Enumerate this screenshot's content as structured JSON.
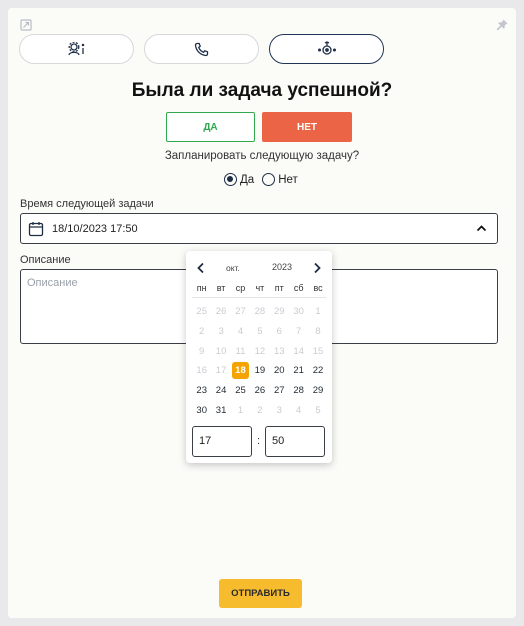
{
  "question_title": "Была ли задача успешной?",
  "answer_buttons": {
    "yes": "ДА",
    "no": "НЕТ"
  },
  "schedule": {
    "question": "Запланировать следующую задачу?",
    "options": [
      {
        "label": "Да",
        "checked": true
      },
      {
        "label": "Нет",
        "checked": false
      }
    ]
  },
  "next_time": {
    "label": "Время следующей задачи",
    "value": "18/10/2023 17:50"
  },
  "description": {
    "label": "Описание",
    "placeholder": "Описание"
  },
  "datepicker": {
    "month": "окт.",
    "year": "2023",
    "weekdays": [
      "пн",
      "вт",
      "ср",
      "чт",
      "пт",
      "сб",
      "вс"
    ],
    "days": [
      {
        "d": "25",
        "muted": true
      },
      {
        "d": "26",
        "muted": true
      },
      {
        "d": "27",
        "muted": true
      },
      {
        "d": "28",
        "muted": true
      },
      {
        "d": "29",
        "muted": true
      },
      {
        "d": "30",
        "muted": true
      },
      {
        "d": "1",
        "muted": true
      },
      {
        "d": "2",
        "muted": true
      },
      {
        "d": "3",
        "muted": true
      },
      {
        "d": "4",
        "muted": true
      },
      {
        "d": "5",
        "muted": true
      },
      {
        "d": "6",
        "muted": true
      },
      {
        "d": "7",
        "muted": true
      },
      {
        "d": "8",
        "muted": true
      },
      {
        "d": "9",
        "muted": true
      },
      {
        "d": "10",
        "muted": true
      },
      {
        "d": "11",
        "muted": true
      },
      {
        "d": "12",
        "muted": true
      },
      {
        "d": "13",
        "muted": true
      },
      {
        "d": "14",
        "muted": true
      },
      {
        "d": "15",
        "muted": true
      },
      {
        "d": "16",
        "muted": true
      },
      {
        "d": "17",
        "muted": true
      },
      {
        "d": "18",
        "selected": true
      },
      {
        "d": "19"
      },
      {
        "d": "20"
      },
      {
        "d": "21"
      },
      {
        "d": "22"
      },
      {
        "d": "23"
      },
      {
        "d": "24"
      },
      {
        "d": "25"
      },
      {
        "d": "26"
      },
      {
        "d": "27"
      },
      {
        "d": "28"
      },
      {
        "d": "29"
      },
      {
        "d": "30"
      },
      {
        "d": "31"
      },
      {
        "d": "1",
        "muted": true
      },
      {
        "d": "2",
        "muted": true
      },
      {
        "d": "3",
        "muted": true
      },
      {
        "d": "4",
        "muted": true
      },
      {
        "d": "5",
        "muted": true
      }
    ],
    "hour": "17",
    "minute": "50",
    "separator": ":"
  },
  "submit_label": "ОТПРАВИТЬ",
  "colors": {
    "accent_yellow": "#f7bb2e",
    "selected_day": "#f5a300",
    "no_button": "#ec6446",
    "yes_border": "#2fa84f",
    "navy": "#1f2d44"
  },
  "icons": [
    "expand-icon",
    "pin-icon",
    "user-info-icon",
    "phone-icon",
    "meeting-icon",
    "calendar-icon",
    "chevron-up-icon",
    "chevron-left-icon",
    "chevron-right-icon"
  ]
}
